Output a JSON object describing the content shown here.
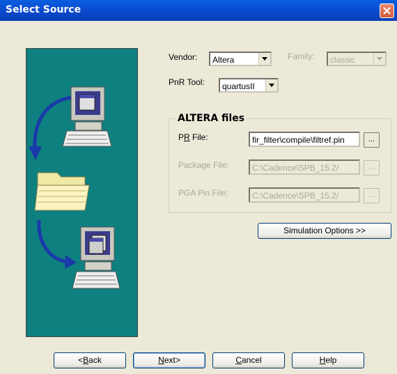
{
  "window": {
    "title": "Select Source"
  },
  "vendor": {
    "label": "Vendor:",
    "value": "Altera"
  },
  "family": {
    "label": "Family:",
    "value": "classic"
  },
  "pnr_tool": {
    "label": "PnR Tool:",
    "value": "quartusII"
  },
  "altera_files": {
    "title": "ALTERA files",
    "pr_file": {
      "label_pre": "P",
      "label_mn": "R",
      "label_post": " File:",
      "value": "fir_filter\\compile\\filtref.pin",
      "browse": "..."
    },
    "package_file": {
      "label": "Package File:",
      "value": "C:\\Cadence\\SPB_15.2/",
      "browse": "..."
    },
    "pga_pin_file": {
      "label": "PGA Pin File:",
      "value": "C:\\Cadence\\SPB_15.2/",
      "browse": "..."
    }
  },
  "simulation_options": {
    "label": "Simulation Options >>"
  },
  "buttons": {
    "back": {
      "pre": "<",
      "mn": "B",
      "post": "ack"
    },
    "next": {
      "pre": "",
      "mn": "N",
      "post": "ext>"
    },
    "cancel": {
      "pre": "",
      "mn": "C",
      "post": "ancel"
    },
    "help": {
      "pre": "",
      "mn": "H",
      "post": "elp"
    }
  },
  "colors": {
    "titlebar": "#0b4bd0",
    "graphic_bg": "#0f8080",
    "dialog_bg": "#ece9d8",
    "disabled_text": "#a9a79a"
  },
  "icons": {
    "close": "close-icon",
    "arrow_down": "chevron-down-icon",
    "computer": "computer-icon",
    "folder": "folder-icon"
  }
}
